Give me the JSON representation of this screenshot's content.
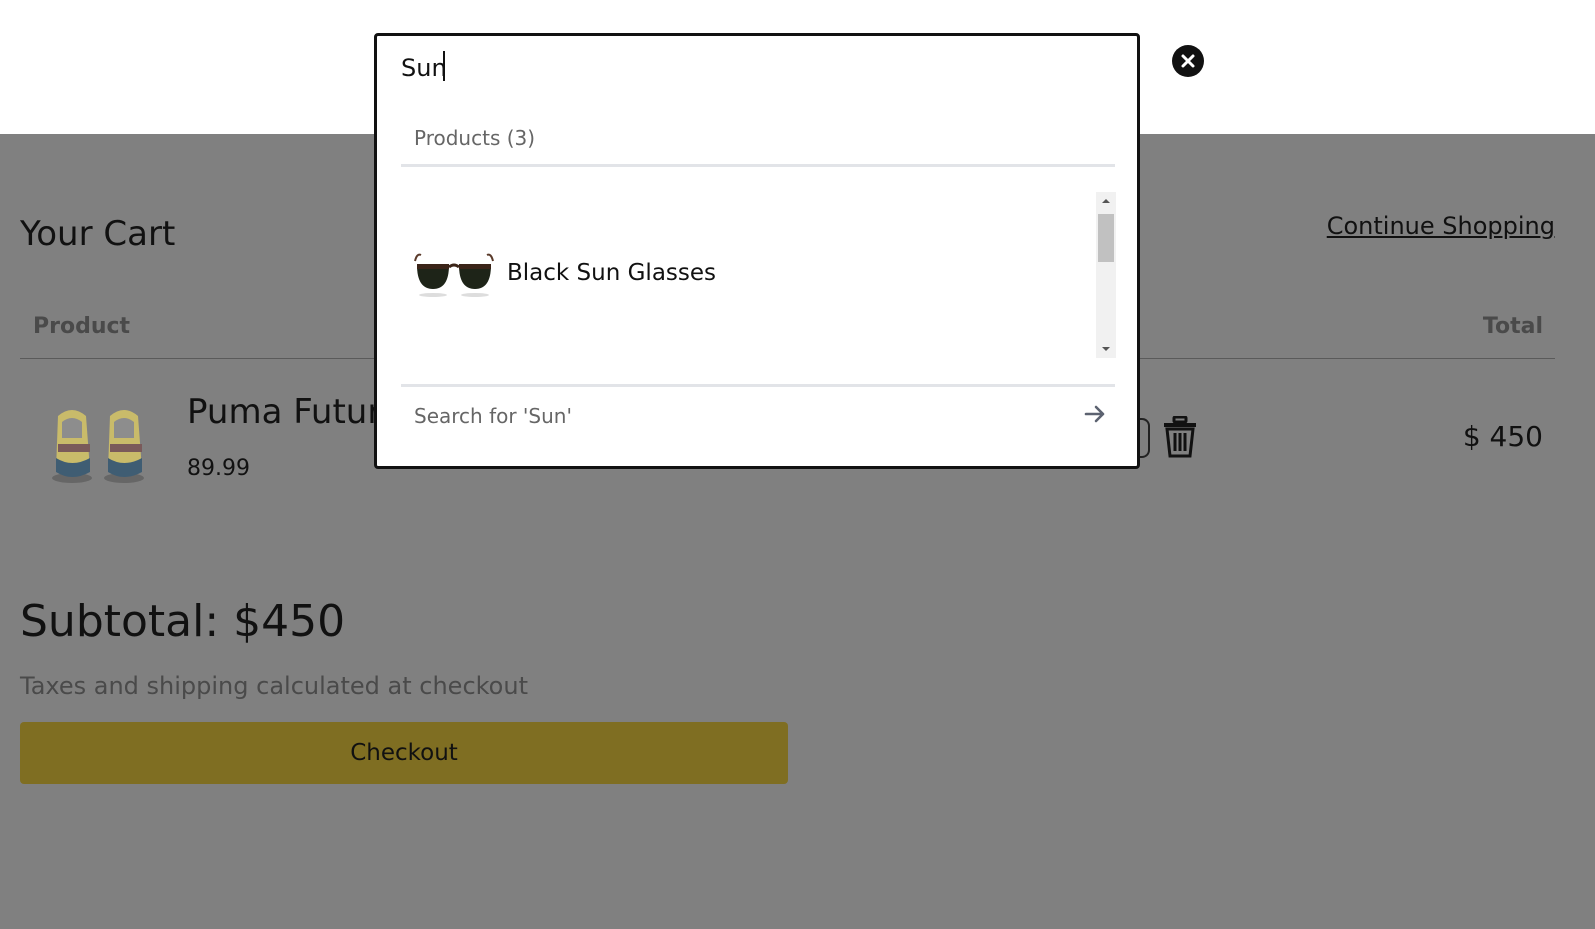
{
  "search": {
    "query": "Sun",
    "products_heading": "Products (3)",
    "results": [
      {
        "label": "Black Sun Glasses",
        "icon": "sunglasses-thumbnail"
      }
    ],
    "search_for_label": "Search for 'Sun'"
  },
  "cart": {
    "title": "Your Cart",
    "continue_shopping": "Continue Shopping",
    "columns": {
      "product": "Product",
      "total": "Total"
    },
    "items": [
      {
        "name": "Puma Futur",
        "price": "89.99",
        "total": "$ 450",
        "icon": "sneakers-thumbnail"
      }
    ],
    "subtotal": "Subtotal: $450",
    "taxes_note": "Taxes and shipping calculated at checkout",
    "checkout_label": "Checkout"
  },
  "colors": {
    "overlay": "#808080",
    "checkout_button": "#7f6e22",
    "modal_border": "#111111"
  }
}
